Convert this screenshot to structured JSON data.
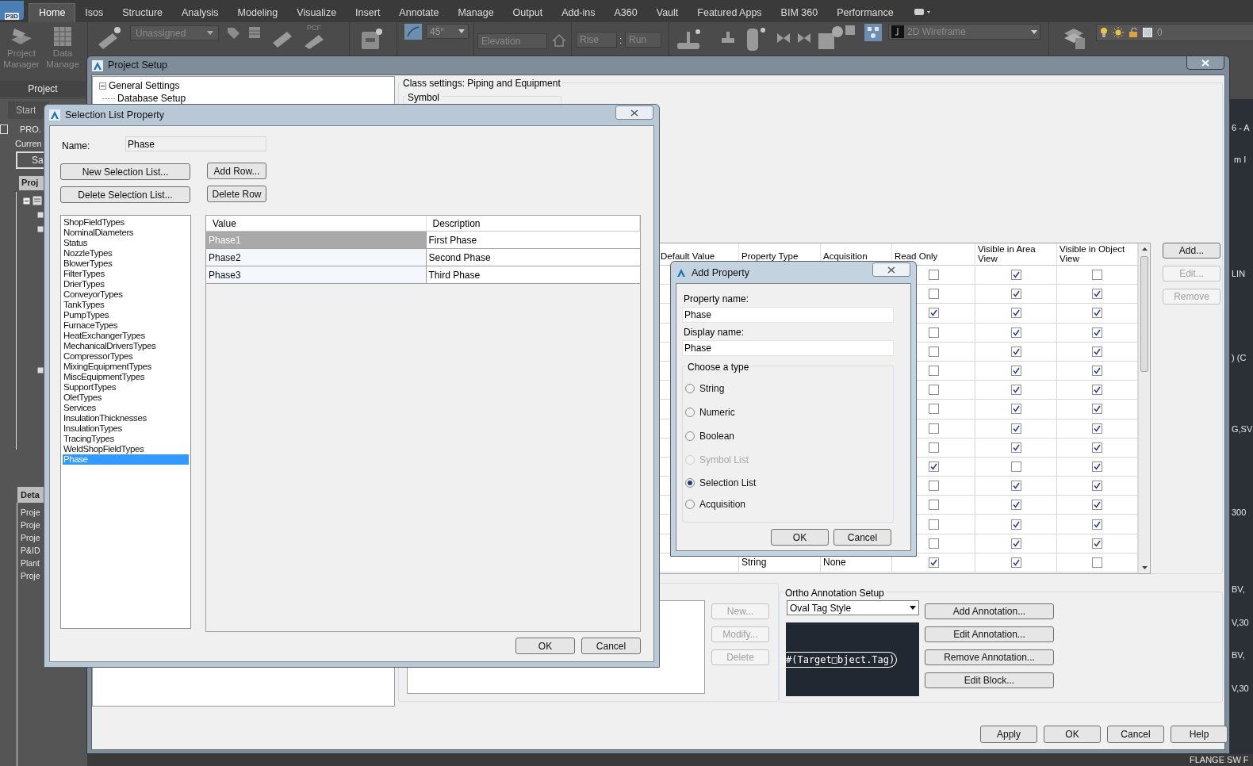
{
  "app_button": {
    "label": "P3D"
  },
  "ribbon_tabs": [
    {
      "label": "Home",
      "selected": true
    },
    {
      "label": "Isos",
      "selected": false
    },
    {
      "label": "Structure",
      "selected": false
    },
    {
      "label": "Analysis",
      "selected": false
    },
    {
      "label": "Modeling",
      "selected": false
    },
    {
      "label": "Visualize",
      "selected": false
    },
    {
      "label": "Insert",
      "selected": false
    },
    {
      "label": "Annotate",
      "selected": false
    },
    {
      "label": "Manage",
      "selected": false
    },
    {
      "label": "Output",
      "selected": false
    },
    {
      "label": "Add-ins",
      "selected": false
    },
    {
      "label": "A360",
      "selected": false
    },
    {
      "label": "Vault",
      "selected": false
    },
    {
      "label": "Featured Apps",
      "selected": false
    },
    {
      "label": "BIM 360",
      "selected": false
    },
    {
      "label": "Performance",
      "selected": false
    }
  ],
  "ribbon": {
    "project_manager": "Project Manager",
    "data_manager": "Data Manage",
    "line_group": "Unassigned",
    "pcf_label": "PCF",
    "slope": "45°",
    "elevation": {
      "placeholder": "Elevation"
    },
    "rise": {
      "placeholder": "Rise"
    },
    "separator": ":",
    "run": {
      "placeholder": "Run"
    },
    "visual_style": "2D Wireframe",
    "layer": "0",
    "panel_title": "Project"
  },
  "palette": {
    "tab": "Start",
    "project": "PRO.",
    "current": "Curren",
    "button": "Sa",
    "tree_header": "Proj",
    "details_header": "Deta",
    "details": [
      "Proje",
      "Proje",
      "Proje",
      "P&ID",
      "Plant",
      "Proje"
    ]
  },
  "drawing_texts": [
    "6 - A",
    "m I",
    "LIN",
    ") (C",
    "G,SV",
    "300",
    "BV,",
    "V,30",
    "BV,",
    "V,30",
    "FLANGE SW F"
  ],
  "project_setup": {
    "title": "Project Setup",
    "tree": [
      {
        "label": "General Settings",
        "expanded": true,
        "children": [
          {
            "label": "Database Setup"
          }
        ]
      }
    ],
    "class_settings": "Class settings: Piping and Equipment",
    "symbol_group": "Symbol",
    "columns": [
      "Default Value",
      "Property Type",
      "Acquisition",
      "Read Only",
      "Visible in Area View",
      "Visible in Object View"
    ],
    "rows": [
      {
        "read_only": false,
        "visible_area": true,
        "visible_object": false
      },
      {
        "read_only": false,
        "visible_area": true,
        "visible_object": true
      },
      {
        "read_only": true,
        "visible_area": true,
        "visible_object": true
      },
      {
        "read_only": false,
        "visible_area": true,
        "visible_object": true
      },
      {
        "read_only": false,
        "visible_area": true,
        "visible_object": true
      },
      {
        "read_only": false,
        "visible_area": true,
        "visible_object": true
      },
      {
        "read_only": false,
        "visible_area": true,
        "visible_object": true
      },
      {
        "read_only": false,
        "visible_area": true,
        "visible_object": true
      },
      {
        "read_only": false,
        "visible_area": true,
        "visible_object": true
      },
      {
        "read_only": false,
        "visible_area": true,
        "visible_object": true
      },
      {
        "read_only": true,
        "visible_area": false,
        "visible_object": true
      },
      {
        "read_only": false,
        "visible_area": true,
        "visible_object": true
      },
      {
        "read_only": false,
        "visible_area": true,
        "visible_object": true
      },
      {
        "read_only": false,
        "visible_area": true,
        "visible_object": true
      },
      {
        "read_only": false,
        "visible_area": true,
        "visible_object": true
      },
      {
        "property_type": "String",
        "acquisition": "None",
        "read_only": true,
        "visible_area": true,
        "visible_object": false
      }
    ],
    "side_buttons": [
      {
        "label": "Add...",
        "disabled": false
      },
      {
        "label": "Edit...",
        "disabled": true
      },
      {
        "label": "Remove",
        "disabled": true
      }
    ],
    "list_buttons": [
      {
        "label": "New...",
        "disabled": true
      },
      {
        "label": "Modify...",
        "disabled": true
      },
      {
        "label": "Delete",
        "disabled": true
      }
    ],
    "ortho_group": "Ortho Annotation Setup",
    "annotation_style": "Oval Tag Style",
    "annotation_preview": "#(Target□bject.Tag)",
    "annotation_buttons": [
      "Add Annotation...",
      "Edit Annotation...",
      "Remove Annotation...",
      "Edit Block..."
    ],
    "footer_buttons": [
      "Apply",
      "OK",
      "Cancel",
      "Help"
    ]
  },
  "selection_list_dialog": {
    "title": "Selection List Property",
    "name_label": "Name:",
    "name_value": "Phase",
    "left_buttons": [
      "New Selection List...",
      "Delete Selection List..."
    ],
    "right_buttons": [
      "Add Row...",
      "Delete Row"
    ],
    "lists": [
      {
        "label": "ShopFieldTypes",
        "selected": false
      },
      {
        "label": "NominalDiameters",
        "selected": false
      },
      {
        "label": "Status",
        "selected": false
      },
      {
        "label": "NozzleTypes",
        "selected": false
      },
      {
        "label": "BlowerTypes",
        "selected": false
      },
      {
        "label": "FilterTypes",
        "selected": false
      },
      {
        "label": "DrierTypes",
        "selected": false
      },
      {
        "label": "ConveyorTypes",
        "selected": false
      },
      {
        "label": "TankTypes",
        "selected": false
      },
      {
        "label": "PumpTypes",
        "selected": false
      },
      {
        "label": "FurnaceTypes",
        "selected": false
      },
      {
        "label": "HeatExchangerTypes",
        "selected": false
      },
      {
        "label": "MechanicalDriversTypes",
        "selected": false
      },
      {
        "label": "CompressorTypes",
        "selected": false
      },
      {
        "label": "MixingEquipmentTypes",
        "selected": false
      },
      {
        "label": "MiscEquipmentTypes",
        "selected": false
      },
      {
        "label": "SupportTypes",
        "selected": false
      },
      {
        "label": "OletTypes",
        "selected": false
      },
      {
        "label": "Services",
        "selected": false
      },
      {
        "label": "InsulationThicknesses",
        "selected": false
      },
      {
        "label": "InsulationTypes",
        "selected": false
      },
      {
        "label": "TracingTypes",
        "selected": false
      },
      {
        "label": "WeldShopFieldTypes",
        "selected": false
      },
      {
        "label": "Phase",
        "selected": true
      }
    ],
    "columns": [
      "Value",
      "Description"
    ],
    "rows": [
      {
        "value": "Phase1",
        "description": "First Phase",
        "selected": true
      },
      {
        "value": "Phase2",
        "description": "Second Phase",
        "selected": false
      },
      {
        "value": "Phase3",
        "description": "Third Phase",
        "selected": false
      }
    ],
    "buttons": [
      "OK",
      "Cancel"
    ]
  },
  "add_property_dialog": {
    "title": "Add Property",
    "property_name_label": "Property name:",
    "property_name": "Phase",
    "display_name_label": "Display name:",
    "display_name": "Phase",
    "type_group": "Choose a type",
    "types": [
      {
        "label": "String",
        "selected": false,
        "disabled": false
      },
      {
        "label": "Numeric",
        "selected": false,
        "disabled": false
      },
      {
        "label": "Boolean",
        "selected": false,
        "disabled": false
      },
      {
        "label": "Symbol List",
        "selected": false,
        "disabled": true
      },
      {
        "label": "Selection List",
        "selected": true,
        "disabled": false
      },
      {
        "label": "Acquisition",
        "selected": false,
        "disabled": false
      }
    ],
    "buttons": [
      "OK",
      "Cancel"
    ]
  }
}
